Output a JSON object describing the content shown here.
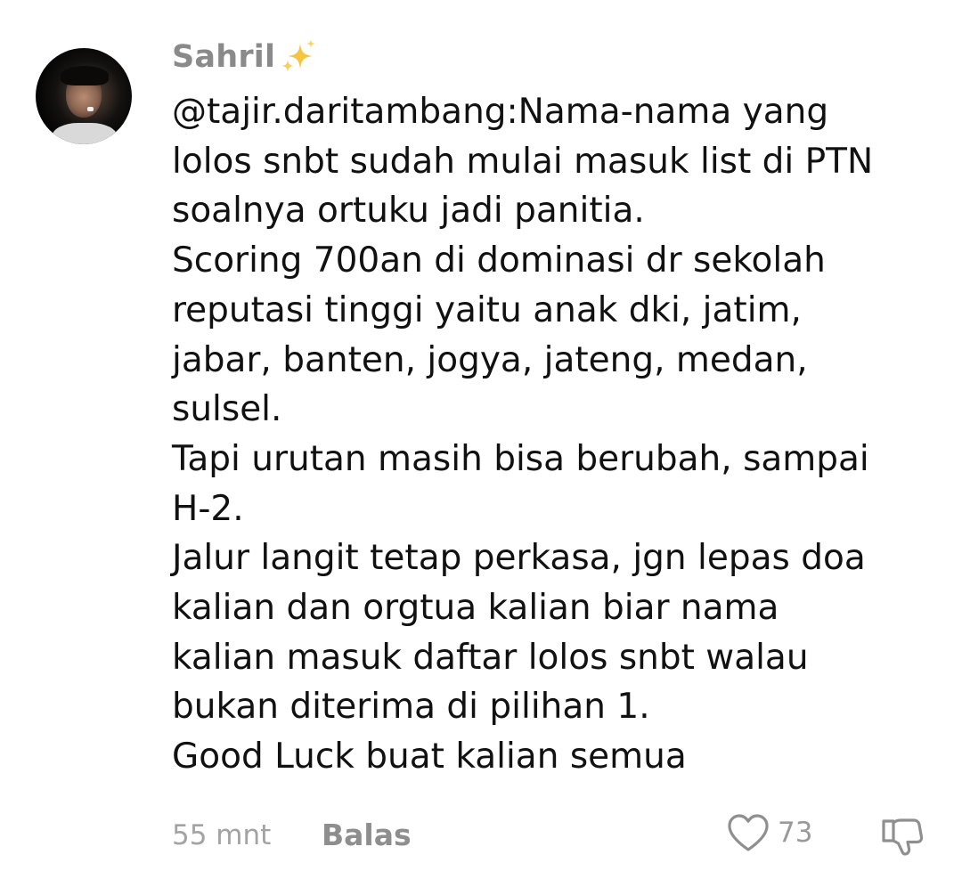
{
  "comment": {
    "username": "Sahril",
    "username_emoji": "sparkles-icon",
    "text_lines": [
      "@tajir.daritambang:Nama-nama yang",
      "lolos snbt sudah mulai masuk list di PTN",
      "soalnya ortuku jadi panitia.",
      "Scoring 700an di dominasi dr sekolah",
      "reputasi tinggi yaitu anak dki, jatim,",
      "jabar, banten, jogya, jateng, medan,",
      "sulsel.",
      "Tapi urutan masih bisa berubah, sampai",
      "H-2.",
      "Jalur langit tetap perkasa, jgn lepas doa",
      "kalian dan orgtua kalian biar nama",
      "kalian masuk daftar lolos snbt walau",
      "bukan diterima di pilihan 1.",
      "Good Luck buat kalian semua"
    ],
    "timestamp": "55 mnt",
    "reply_label": "Balas",
    "like_count": "73",
    "like_icon": "heart-outline-icon",
    "dislike_icon": "thumbs-down-outline-icon"
  },
  "colors": {
    "username": "#8a8a8a",
    "text": "#111111",
    "meta": "#a3a3a3",
    "reply": "#8e8e8e",
    "sparkle": "#f5c542"
  }
}
